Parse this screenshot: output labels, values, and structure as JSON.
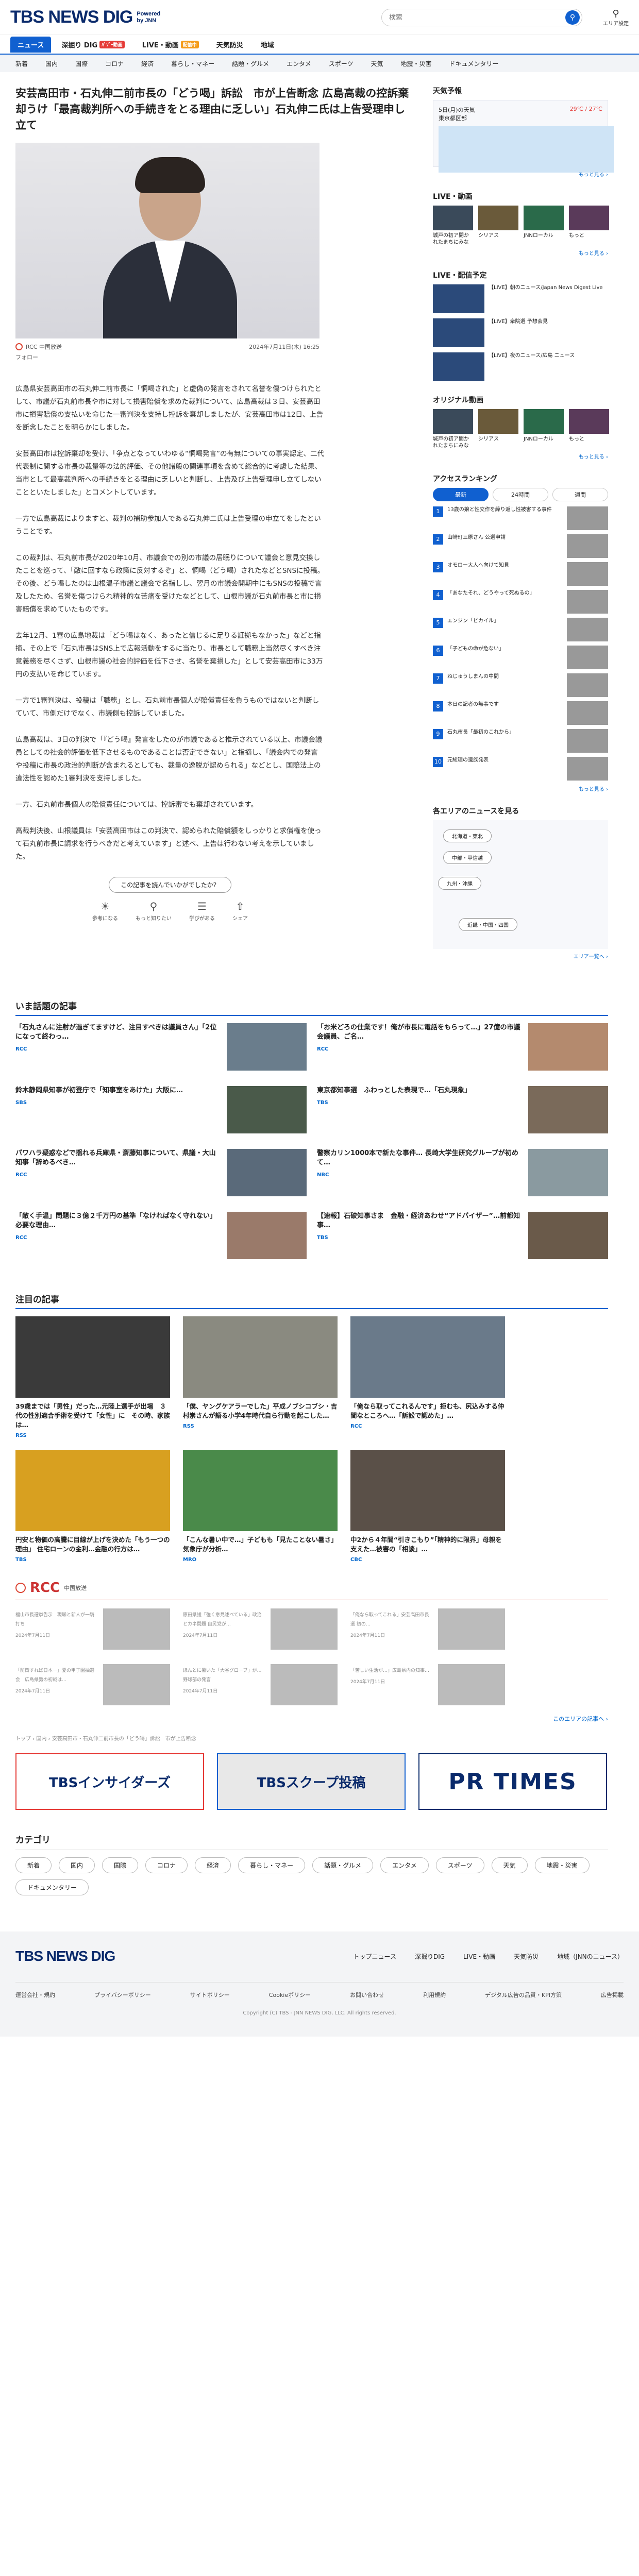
{
  "header": {
    "logo_main": "TBS NEWS DIG",
    "logo_sub1": "Powered",
    "logo_sub2": "by JNN",
    "search_placeholder": "検索",
    "area_label": "エリア設定"
  },
  "nav1": [
    {
      "label": "ニュース",
      "active": true
    },
    {
      "label": "深掘り DIG",
      "badge": "ﾊﾞｿﾞｰ動画"
    },
    {
      "label": "LIVE・動画",
      "badge": "配信中"
    },
    {
      "label": "天気防災"
    },
    {
      "label": "地域"
    }
  ],
  "nav2": [
    "新着",
    "国内",
    "国際",
    "コロナ",
    "経済",
    "暮らし・マネー",
    "話題・グルメ",
    "エンタメ",
    "スポーツ",
    "天気",
    "地震・災害",
    "ドキュメンタリー"
  ],
  "article": {
    "title": "安芸高田市・石丸伸二前市長の「どう喝」訴訟　市が上告断念 広島高裁の控訴棄却うけ「最高裁判所への手続きをとる理由に乏しい」石丸伸二氏は上告受理申し立て",
    "source": "RCC 中国放送",
    "follow": "フォロー",
    "date": "2024年7月11日(木) 16:25",
    "paragraphs": [
      "広島県安芸高田市の石丸伸二前市長に「恫喝された」と虚偽の発言をされて名誉を傷つけられたとして、市議が石丸前市長や市に対して損害賠償を求めた裁判について、広島高裁は３日、安芸高田市に損害賠償の支払いを命じた一審判決を支持し控訴を棄却しましたが、安芸高田市は12日、上告を断念したことを明らかにしました。",
      "安芸高田市は控訴棄却を受け、「争点となっていわゆる“恫喝発言”の有無についての事実認定、二代代表制に関する市長の裁量等の法的評価、その他諸般の関連事項を含めて総合的に考慮した結果、当市として最高裁判所への手続きをとる理由に乏しいと判断し、上告及び上告受理申し立てしないことといたしました」とコメントしています。",
      "一方で広島高裁によりますと、裁判の補助参加人である石丸伸二氏は上告受理の申立てをしたということです。",
      "この裁判は、石丸前市長が2020年10月、市議会での別の市議の居眠りについて議会と意見交換したことを巡って、「敵に回すなら政策に反対するぞ」と、恫喝（どう喝）されたなどとSNSに投稿。その後、どう喝したのは山根温子市議と議会で名指しし、翌月の市議会開期中にもSNSの投稿で言及したため、名誉を傷つけられ精神的な苦痛を受けたなどとして、山根市議が石丸前市長と市に損害賠償を求めていたものです。",
      "去年12月、1審の広島地裁は「どう喝はなく、あったと信じるに足りる証拠もなかった」などと指摘。その上で「石丸市長はSNS上で広報活動をするに当たり、市長として職務上当然尽くすべき注意義務を尽くさず、山根市議の社会的評価を低下させ、名誉を棄損した」として安芸高田市に33万円の支払いを命じています。",
      "一方で1審判決は、投稿は「職務」とし、石丸前市長個人が賠償責任を負うものではないと判断していて、市側だけでなく、市議側も控訴していました。",
      "広島高裁は、3日の判決で「『どう喝』発言をしたのが市議であると推示されている以上、市議会議員としての社会的評価を低下させるものであることは否定できない」と指摘し、「議会内での発言や投稿に市長の政治的判断が含まれるとしても、裁量の逸脱が認められる」などとし、国賠法上の違法性を認めた1審判決を支持しました。",
      "一方、石丸前市長個人の賠償責任については、控訴審でも棄却されています。",
      "高裁判決後、山根議員は「安芸高田市はこの判決で、認められた賠償額をしっかりと求償権を使って石丸前市長に請求を行うべきだと考えています」と述べ、上告は行わない考えを示していました。"
    ],
    "feedback_q": "この記事を読んでいかがでしたか？",
    "feedback": [
      {
        "icon": "lightbulb",
        "label": "参考になる"
      },
      {
        "icon": "search",
        "label": "もっと知りたい"
      },
      {
        "icon": "book",
        "label": "学びがある"
      },
      {
        "icon": "share",
        "label": "シェア"
      }
    ]
  },
  "talk": {
    "title": "いま話題の記事",
    "items": [
      {
        "text": "「石丸さんに注射が過ぎてますけど、注目すべきは議員さん」「2位になって終わっ…",
        "src": "RCC"
      },
      {
        "text": "「お米どろの仕業です！俺が市長に電話をもらって…」27億の市議会議員、ご名…",
        "src": "RCC"
      },
      {
        "text": "鈴木静岡県知事が初登庁で「知事室をあけた」大阪に…",
        "src": "SBS"
      },
      {
        "text": "東京都知事選　ふわっとした表現で…「石丸現象」",
        "src": "TBS"
      },
      {
        "text": "パワハラ疑惑などで揺れる兵庫県・斎藤知事について、県議・大山知事「辞めるべき…",
        "src": "RCC"
      },
      {
        "text": "警察カリン1000本で新たな事件… 長崎大学生研究グループが初めて…",
        "src": "NBC"
      },
      {
        "text": "「敵く手温」問題に３億２千万円の基準「なければなく守れない」必要な理由…",
        "src": "RCC"
      },
      {
        "text": "【速報】石破知事さま　金融・経済あわせ“アドバイザー”…前都知事…",
        "src": "TBS"
      }
    ]
  },
  "attention": {
    "title": "注目の記事",
    "items": [
      {
        "text": "39歳までは「男性」だった…元陸上選手が出場　３代の性別適合手術を受けて「女性」に　その時、家族は…",
        "src": "RSS"
      },
      {
        "text": "「僕、ヤングケアラーでした」平成ノブシコブシ・吉村崇さんが語る小学4年時代自ら行動を起こした…",
        "src": "RSS"
      },
      {
        "text": "「俺なら取ってこれるんです」拒むも、尻込みする仲間なところへ…「訴訟で認めた」…",
        "src": "RCC"
      },
      {
        "text": "円安と物価の高騰に目線が上げを決めた「もう一つの理由」 住宅ローンの金利…金融の行方は…",
        "src": "TBS"
      },
      {
        "text": "「こんな暑い中で…」子どもも「見たことない暑さ」 気象庁が分析…",
        "src": "MRO"
      },
      {
        "text": "中2から４年間“引きこもり”「精神的に限界」母親を支えた…被害の「相談」…",
        "src": "CBC"
      }
    ]
  },
  "rcc": {
    "name": "RCC",
    "label": "中国放送",
    "items": [
      {
        "text": "福山市長選挙告示　現職と新人が一騎打ち",
        "date": "2024年7月11日"
      },
      {
        "text": "原田県議「強く意見述べている」政治とカネ問題 自民党が…",
        "date": "2024年7月11日"
      },
      {
        "text": "「俺なら取ってこれる」安芸高田市長選 初の…",
        "date": "2024年7月11日"
      },
      {
        "text": "「防衛すれば日本一」夏の甲子園抽選会　広島県勢の初戦は…",
        "date": "2024年7月11日"
      },
      {
        "text": "ほんとに暑いた「大谷グローブ」が…野球部の発言",
        "date": "2024年7月11日"
      },
      {
        "text": "「苦しい生活が…」広島県内の知事…",
        "date": "2024年7月11日"
      }
    ],
    "more": "このエリアの記事へ ›"
  },
  "crumbs": "トップ › 国内 › 安芸高田市・石丸伸二前市長の「どう喝」訴訟　市が上告断念",
  "banners": [
    "TBSインサイダーズ",
    "TBSスクープ投稿",
    "PR TIMES"
  ],
  "categories": {
    "title": "カテゴリ",
    "items": [
      "新着",
      "国内",
      "国際",
      "コロナ",
      "経済",
      "暮らし・マネー",
      "話題・グルメ",
      "エンタメ",
      "スポーツ",
      "天気",
      "地震・災害",
      "ドキュメンタリー"
    ]
  },
  "footer": {
    "logo": "TBS NEWS DIG",
    "links": [
      "トップニュース",
      "深掘りDIG",
      "LIVE・動画",
      "天気防災",
      "地域（JNNのニュース）"
    ],
    "sub": [
      "運営会社・規約",
      "プライバシーポリシー",
      "サイトポリシー",
      "Cookieポリシー",
      "お問い合わせ",
      "利用規約",
      "デジタル広告の品質・KPI方策",
      "広告掲載"
    ],
    "copy": "Copyright (C) TBS - JNN NEWS DIG, LLC. All rights reserved."
  },
  "side": {
    "weather_title": "天気予報",
    "weather_date": "5日(月)の天気",
    "weather_area": "東京都区部",
    "weather_temp": "29℃ / 27℃",
    "live_title": "LIVE・動画",
    "live_items": [
      "城戸の初ア開かれたまちにみな",
      "シリアス",
      "JNNローカル",
      "もっと"
    ],
    "stream_title": "LIVE・配信予定",
    "stream_items": [
      "【LIVE】朝のニュース/Japan News Digest Live",
      "【LIVE】衆院選 予想会見",
      "【LIVE】夜のニュース/広島 ニュース"
    ],
    "original_title": "オリジナル動画",
    "ranking_title": "アクセスランキング",
    "ranking_tabs": [
      "最新",
      "24時間",
      "週間"
    ],
    "ranking_items": [
      "13歳の娘と性交作を繰り返し性被害する事件",
      "山崎町三原さん 公選申請",
      "オモロー大人へ向けて知見",
      "「あなたそれ、どうやって死ぬるの」",
      "エンジン「ピカイル」",
      "「子どもの命が危ない」",
      "ねじゅうしまんの中間",
      "本日の記者の無事です",
      "石丸市長「最初のこれから」",
      "元総理の遺族発表"
    ],
    "regions_title": "各エリアのニュースを見る",
    "regions": [
      "北海道・東北",
      "中部・甲信越",
      "九州・沖縄",
      "近畿・中国・四国"
    ],
    "region_more": "エリア一覧へ ›",
    "more": "もっと見る ›"
  }
}
